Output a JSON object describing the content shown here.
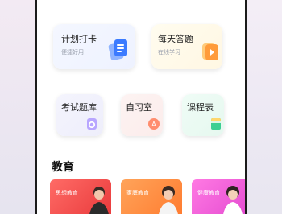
{
  "cards_top": [
    {
      "title": "计划打卡",
      "subtitle": "便捷好用",
      "icon": "clipboard-icon"
    },
    {
      "title": "每天答题",
      "subtitle": "在线学习",
      "icon": "play-file-icon"
    }
  ],
  "cards_mid": [
    {
      "title": "考试题库",
      "icon": "question-bank-icon"
    },
    {
      "title": "自习室",
      "icon": "study-room-icon"
    },
    {
      "title": "课程表",
      "icon": "timetable-icon"
    }
  ],
  "section": {
    "title": "教育"
  },
  "banners": [
    {
      "label": "思想教育",
      "color": "#f04d4f"
    },
    {
      "label": "家庭教育",
      "color": "#ff8a3d"
    },
    {
      "label": "健康教育",
      "color": "#ee5ad8"
    }
  ]
}
